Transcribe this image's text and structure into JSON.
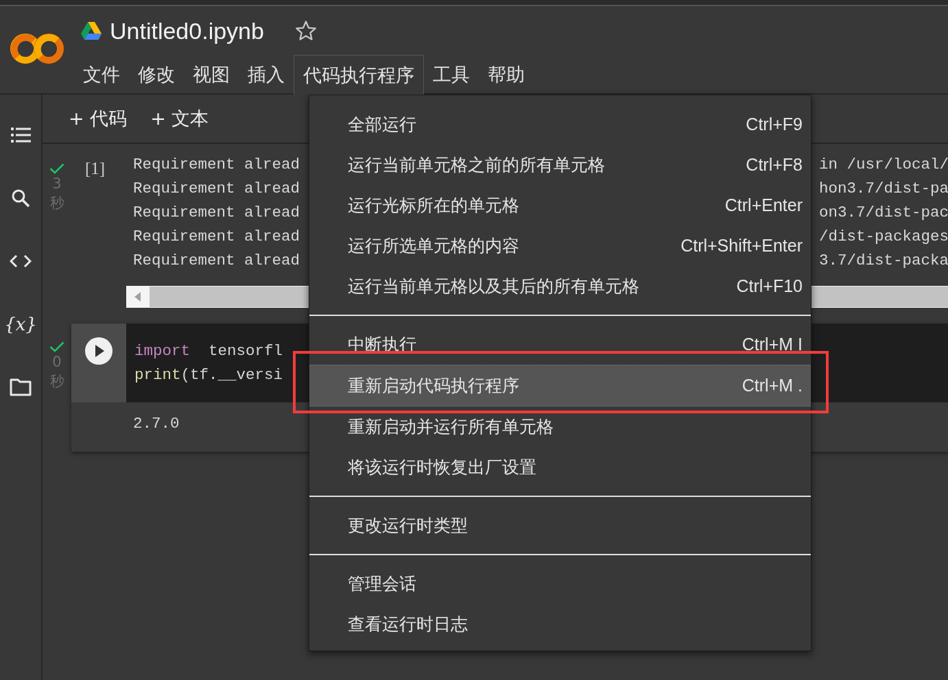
{
  "header": {
    "title": "Untitled0.ipynb",
    "starred": false
  },
  "menubar": [
    {
      "label": "文件",
      "selected": false
    },
    {
      "label": "修改",
      "selected": false
    },
    {
      "label": "视图",
      "selected": false
    },
    {
      "label": "插入",
      "selected": false
    },
    {
      "label": "代码执行程序",
      "selected": true
    },
    {
      "label": "工具",
      "selected": false
    },
    {
      "label": "帮助",
      "selected": false
    }
  ],
  "sidebar": [
    {
      "kind": "toc"
    },
    {
      "kind": "search"
    },
    {
      "kind": "code"
    },
    {
      "kind": "variables",
      "glyph": "{x}"
    },
    {
      "kind": "files"
    }
  ],
  "toolbar": [
    "+ 代码",
    "+ 文本"
  ],
  "cells": [
    {
      "kind": "output",
      "succeeded": true,
      "exec_count": "[1]",
      "duration": "3",
      "unit": "秒",
      "lines": [
        {
          "left": "Requirement alread",
          "right": "in /usr/local/"
        },
        {
          "left": "Requirement alread",
          "right": "hon3.7/dist-pa"
        },
        {
          "left": "Requirement alread",
          "right": "on3.7/dist-pac"
        },
        {
          "left": "Requirement alread",
          "right": "/dist-packages"
        },
        {
          "left": "Requirement alread",
          "right": "3.7/dist-packa"
        }
      ]
    },
    {
      "kind": "code",
      "succeeded": true,
      "duration": "0",
      "unit": "秒",
      "code": [
        [
          {
            "t": "import",
            "kind": "keyword"
          },
          {
            "t": "  tensorfl",
            "kind": "plain"
          }
        ],
        [
          {
            "t": "print",
            "kind": "builtin"
          },
          {
            "t": "(tf.__versi",
            "kind": "plain"
          }
        ]
      ],
      "output": "2.7.0"
    }
  ],
  "dropdown": [
    {
      "kind": "item",
      "label": "全部运行",
      "shortcut": "Ctrl+F9",
      "selected": false
    },
    {
      "kind": "item",
      "label": "运行当前单元格之前的所有单元格",
      "shortcut": "Ctrl+F8",
      "selected": false
    },
    {
      "kind": "item",
      "label": "运行光标所在的单元格",
      "shortcut": "Ctrl+Enter",
      "selected": false
    },
    {
      "kind": "item",
      "label": "运行所选单元格的内容",
      "shortcut": "Ctrl+Shift+Enter",
      "selected": false
    },
    {
      "kind": "item",
      "label": "运行当前单元格以及其后的所有单元格",
      "shortcut": "Ctrl+F10",
      "selected": false
    },
    {
      "kind": "divider"
    },
    {
      "kind": "item",
      "label": "中断执行",
      "shortcut": "Ctrl+M I",
      "selected": false
    },
    {
      "kind": "item",
      "label": "重新启动代码执行程序",
      "shortcut": "Ctrl+M .",
      "selected": true,
      "annotated": true
    },
    {
      "kind": "item",
      "label": "重新启动并运行所有单元格",
      "selected": false
    },
    {
      "kind": "item",
      "label": "将该运行时恢复出厂设置",
      "selected": false
    },
    {
      "kind": "divider"
    },
    {
      "kind": "item",
      "label": "更改运行时类型",
      "selected": false
    },
    {
      "kind": "divider"
    },
    {
      "kind": "item",
      "label": "管理会话",
      "selected": false
    },
    {
      "kind": "item",
      "label": "查看运行时日志",
      "selected": false
    }
  ]
}
